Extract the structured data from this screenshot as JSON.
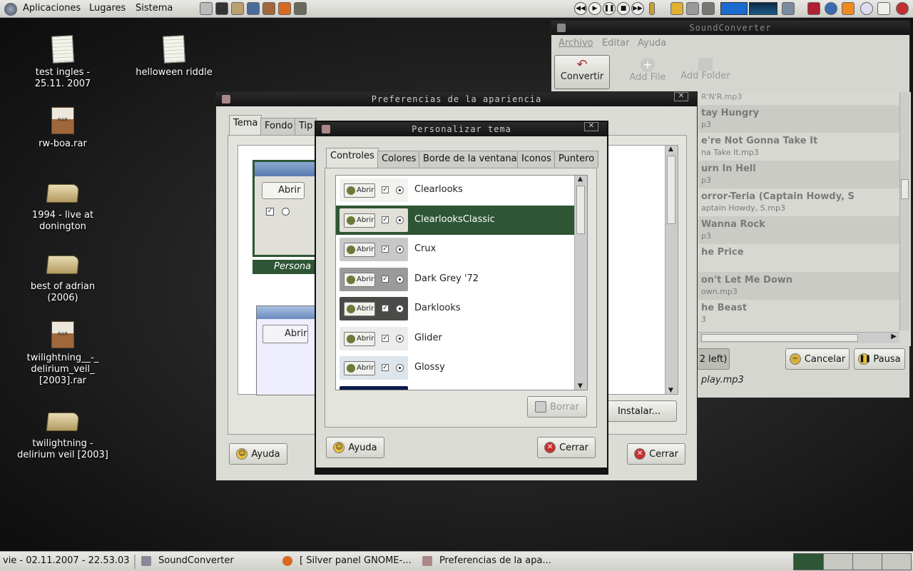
{
  "top_panel": {
    "menus": [
      "Aplicaciones",
      "Lugares",
      "Sistema"
    ],
    "launcher_icons": [
      "trash-icon",
      "terminal-icon",
      "file-manager-icon",
      "monitor-icon",
      "archive-icon",
      "firefox-icon",
      "gimp-icon"
    ],
    "media_controls": [
      "previous-icon",
      "play-icon",
      "pause-icon",
      "stop-icon",
      "next-icon"
    ]
  },
  "desktop": {
    "icons": [
      {
        "label": "test ingles - 25.11. 2007",
        "type": "paper"
      },
      {
        "label": "helloween riddle",
        "type": "paper"
      },
      {
        "label": "rw-boa.rar",
        "type": "rar",
        "badge": "RAR"
      },
      {
        "label": "1994 - live at donington",
        "type": "folder"
      },
      {
        "label": "best of adrian (2006)",
        "type": "folder"
      },
      {
        "label": "twilightning__-_ delirium_veil_ [2003].rar",
        "type": "rar",
        "badge": "RAR"
      },
      {
        "label": "twilightning - delirium veil [2003]",
        "type": "folder"
      }
    ]
  },
  "soundconverter": {
    "title": "SoundConverter",
    "menus": [
      "Archivo",
      "Editar",
      "Ayuda"
    ],
    "toolbar": {
      "convert": "Convertir",
      "add_file": "Add File",
      "add_folder": "Add Folder"
    },
    "partial_top": "R'N'R.mp3",
    "rows": [
      {
        "t1": "tay Hungry",
        "t2": "p3"
      },
      {
        "t1": "e're Not Gonna Take It",
        "t2": "na Take It.mp3"
      },
      {
        "t1": "urn In Hell",
        "t2": "p3"
      },
      {
        "t1": "orror-Teria (Captain Howdy, S",
        "t2": "aptain Howdy, S.mp3"
      },
      {
        "t1": "Wanna Rock",
        "t2": "p3"
      },
      {
        "t1": "he Price",
        "t2": ""
      },
      {
        "t1": "on't Let Me Down",
        "t2": "own.mp3"
      },
      {
        "t1": "he Beast",
        "t2": "3"
      }
    ],
    "remaining": "2 left)",
    "cancel": "Cancelar",
    "pause": "Pausa",
    "current_file": "play.mp3"
  },
  "appearance": {
    "title": "Preferencias de la apariencia",
    "tabs": [
      "Tema",
      "Fondo",
      "Tip"
    ],
    "preview_abrir": "Abrir",
    "personalize_label": "Persona",
    "install": "Instalar...",
    "help": "Ayuda",
    "close": "Cerrar"
  },
  "customize": {
    "title": "Personalizar tema",
    "tabs": [
      "Controles",
      "Colores",
      "Borde de la ventana",
      "Iconos",
      "Puntero"
    ],
    "preview_button": "Abrir",
    "themes": [
      {
        "name": "Clearlooks",
        "bg": "#f2f2ee",
        "selected": false
      },
      {
        "name": "ClearlooksClassic",
        "bg": "#e0e0d8",
        "selected": true
      },
      {
        "name": "Crux",
        "bg": "#c8c8c8",
        "selected": false
      },
      {
        "name": "Dark Grey '72",
        "bg": "#9a9a9a",
        "selected": false
      },
      {
        "name": "Darklooks",
        "bg": "#4a4a48",
        "selected": false
      },
      {
        "name": "Glider",
        "bg": "#ececec",
        "selected": false
      },
      {
        "name": "Glossy",
        "bg": "#dce4ec",
        "selected": false
      }
    ],
    "delete": "Borrar",
    "help": "Ayuda",
    "close": "Cerrar"
  },
  "bottom_panel": {
    "clock": "vie - 02.11.2007 - 22.53.03",
    "tasks": [
      "SoundConverter",
      "[ Silver panel GNOME-...",
      "Preferencias de la apa..."
    ]
  }
}
